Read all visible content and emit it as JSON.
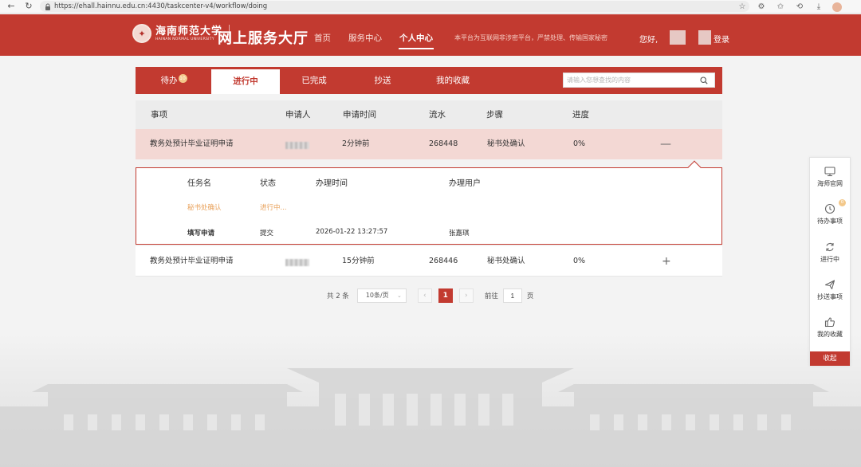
{
  "browser": {
    "url": "https://ehall.hainnu.edu.cn:4430/taskcenter-v4/workflow/doing",
    "back_icon": "arrow-left-icon",
    "refresh_icon": "refresh-icon"
  },
  "header": {
    "logo_cn": "海南师范大学",
    "logo_en": "HAINAN NORMAL UNIVERSITY",
    "site_title": "网上服务大厅",
    "nav": [
      {
        "label": "首页",
        "active": false
      },
      {
        "label": "服务中心",
        "active": false
      },
      {
        "label": "个人中心",
        "active": true
      }
    ],
    "notice": "本平台为互联网非涉密平台，严禁处理、传输国家秘密",
    "greeting": "您好,",
    "login": "登录",
    "brand_color": "#c23a30"
  },
  "tabs": [
    {
      "label": "待办",
      "badge": "10",
      "active": false
    },
    {
      "label": "进行中",
      "active": true
    },
    {
      "label": "已完成",
      "active": false
    },
    {
      "label": "抄送",
      "active": false
    },
    {
      "label": "我的收藏",
      "active": false
    }
  ],
  "search": {
    "placeholder": "请输入您想查找的内容"
  },
  "table": {
    "columns": [
      "事项",
      "申请人",
      "申请时间",
      "流水",
      "步骤",
      "进度"
    ],
    "rows": [
      {
        "item": "教务处预计毕业证明申请",
        "time": "2分钟前",
        "serial": "268448",
        "step": "秘书处确认",
        "progress": "0%",
        "expanded": true,
        "toggle": "—"
      },
      {
        "item": "教务处预计毕业证明申请",
        "time": "15分钟前",
        "serial": "268446",
        "step": "秘书处确认",
        "progress": "0%",
        "expanded": false,
        "toggle": "+"
      }
    ],
    "detail": {
      "columns": [
        "任务名",
        "状态",
        "办理时间",
        "办理用户"
      ],
      "rows": [
        {
          "task": "秘书处确认",
          "status": "进行中...",
          "time": "",
          "user": ""
        },
        {
          "task": "填写申请",
          "status": "提交",
          "time": "2026-01-22 13:27:57",
          "user": "张嘉琪"
        }
      ]
    }
  },
  "pagination": {
    "total": "共 2 条",
    "page_size": "10条/页",
    "current": "1",
    "goto_label": "前往",
    "goto_value": "1",
    "page_unit": "页"
  },
  "float_panel": {
    "items": [
      {
        "label": "海师官网",
        "icon": "monitor-icon"
      },
      {
        "label": "待办事项",
        "icon": "clock-icon",
        "badge": "0"
      },
      {
        "label": "进行中",
        "icon": "loop-icon"
      },
      {
        "label": "抄送事项",
        "icon": "paper-plane-icon"
      },
      {
        "label": "我的收藏",
        "icon": "thumbs-up-icon"
      }
    ],
    "collapse": "收起"
  }
}
